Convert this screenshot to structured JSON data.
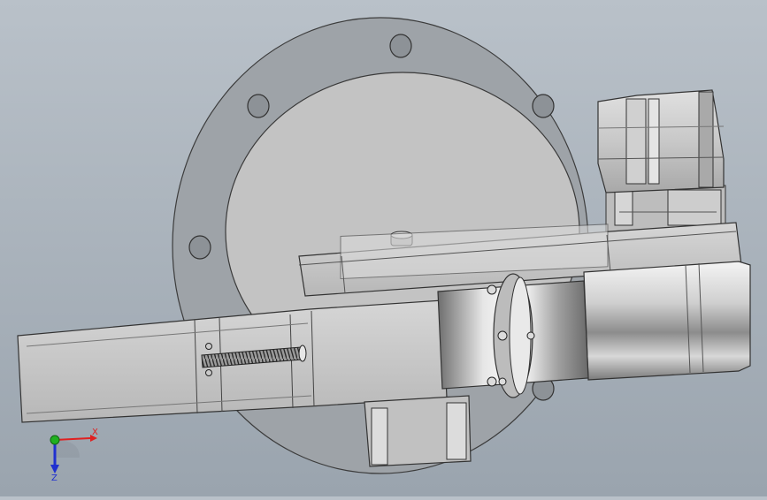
{
  "viewport": {
    "background_top": "#b9c1c9",
    "background_bottom": "#9aa4ae"
  },
  "triad": {
    "x_label": "X",
    "y_label": "Y",
    "z_label": "Z",
    "x_color": "#e02020",
    "y_color": "#20b020",
    "z_color": "#2030d0"
  },
  "model": {
    "parts": [
      "flange-disc",
      "valve-plate",
      "motor",
      "gearbox",
      "support-beam",
      "slider-body",
      "lead-screw",
      "coupling-hub",
      "actuator-cylinder",
      "mount-bracket"
    ]
  }
}
